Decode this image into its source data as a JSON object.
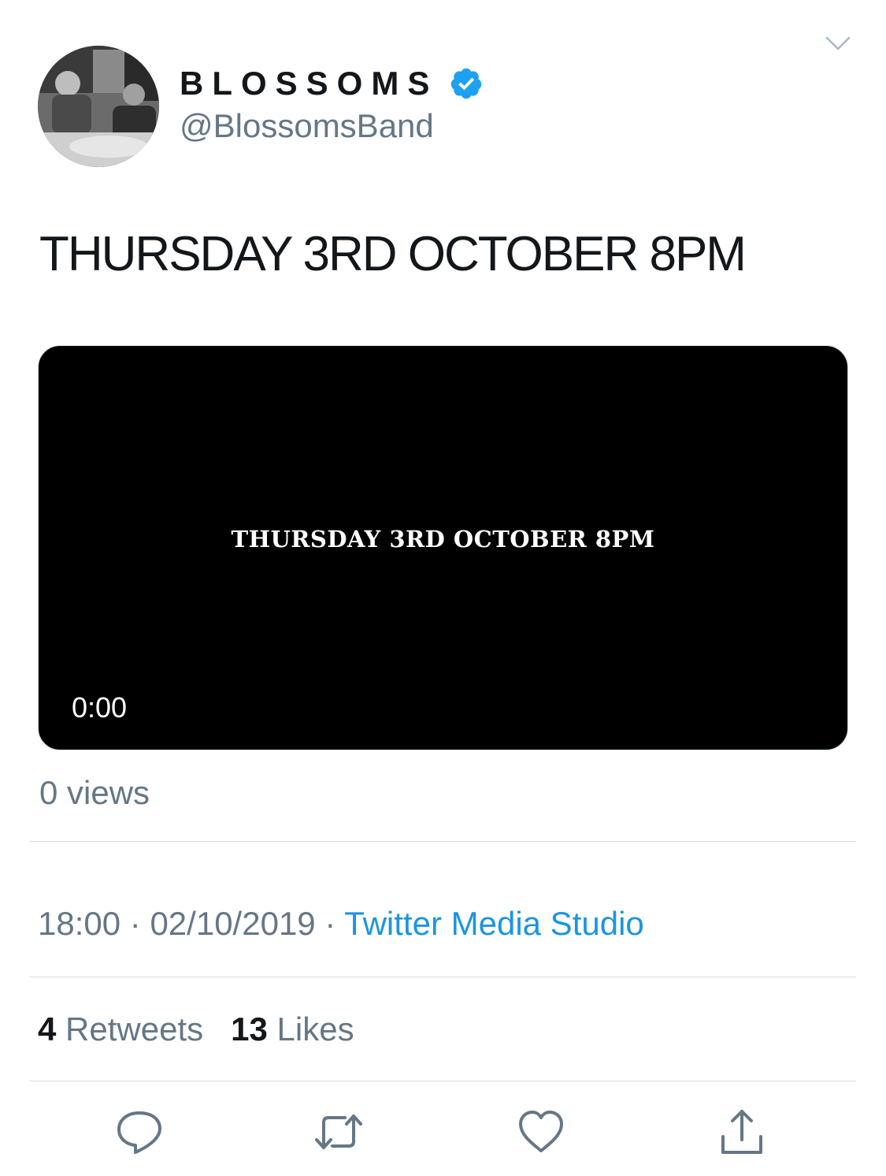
{
  "author": {
    "display_name": "BLOSSOMS",
    "handle": "@BlossomsBand",
    "verified": true
  },
  "tweet": {
    "text": "THURSDAY 3RD OCTOBER 8PM"
  },
  "video": {
    "caption": "THURSDAY 3RD OCTOBER 8PM",
    "time": "0:00"
  },
  "views": "0 views",
  "meta": {
    "time": "18:00",
    "separator": "·",
    "date": "02/10/2019",
    "source": "Twitter Media Studio"
  },
  "stats": {
    "retweets_count": "4",
    "retweets_label": "Retweets",
    "likes_count": "13",
    "likes_label": "Likes"
  },
  "icons": {
    "verified": "verified-badge-icon",
    "more": "chevron-down-icon",
    "reply": "reply-icon",
    "retweet": "retweet-icon",
    "like": "heart-icon",
    "share": "share-icon"
  },
  "colors": {
    "link": "#1b95e0",
    "secondary_text": "#657786",
    "primary_text": "#14171a",
    "verified": "#1da1f2",
    "video_bg": "#000000"
  }
}
